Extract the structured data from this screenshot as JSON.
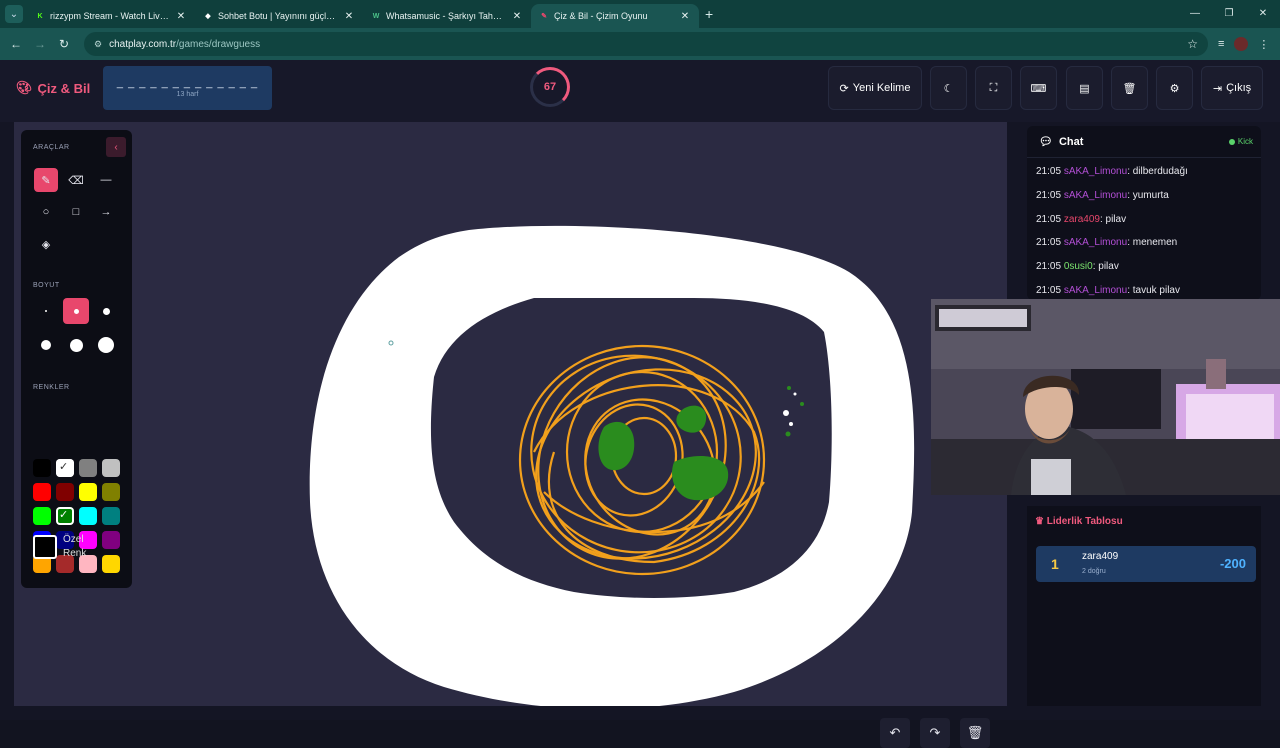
{
  "browser": {
    "tabs": [
      {
        "title": "rizzypm Stream - Watch Live on",
        "icon_color": "#53fc18",
        "icon": "K",
        "active": false
      },
      {
        "title": "Sohbet Botu | Yayınını güçlendir",
        "icon_color": "#ffffff",
        "icon": "◆",
        "active": false
      },
      {
        "title": "Whatsamusic - Şarkıyı Tahmin Et",
        "icon_color": "#4cc38a",
        "icon": "W",
        "active": false
      },
      {
        "title": "Çiz & Bil - Çizim Oyunu",
        "icon_color": "#e8476c",
        "icon": "✎",
        "active": true
      }
    ],
    "url_host": "chatplay.com.tr",
    "url_path": "/games/drawguess",
    "new_tab": "+"
  },
  "app": {
    "brand": "Çiz & Bil",
    "word_mask": "_ _ _ _ _ _ _ _ _ _ _ _ _",
    "word_hint": "13 harf",
    "timer": "67",
    "timer_fraction": 0.25,
    "buttons": {
      "new_word": "Yeni Kelime",
      "exit": "Çıkış"
    }
  },
  "tools": {
    "tools_label": "ARAÇLAR",
    "size_label": "BOYUT",
    "colors_label": "RENKLER",
    "custom_color": [
      "Özel",
      "Renk"
    ],
    "selected_tool": "brush",
    "selected_size": 1,
    "colors": [
      "#000000",
      "#ffffff",
      "#808080",
      "#c0c0c0",
      "#ff0000",
      "#800000",
      "#ffff00",
      "#808000",
      "#00ff00",
      "#008000",
      "#00ffff",
      "#008080",
      "#0000ff",
      "#000080",
      "#ff00ff",
      "#800080",
      "#ffa500",
      "#a52a2a",
      "#ffb6c1",
      "#ffd700"
    ],
    "selected_colors": [
      "#ffffff",
      "#008000"
    ]
  },
  "chat": {
    "title": "Chat",
    "platform": "Kick",
    "messages": [
      {
        "time": "21:05",
        "user": "sAKA_Limonu",
        "user_color": "purple",
        "text": ": dilberdudağı"
      },
      {
        "time": "21:05",
        "user": "sAKA_Limonu",
        "user_color": "purple",
        "text": ": yumurta"
      },
      {
        "time": "21:05",
        "user": "zara409",
        "user_color": "red",
        "text": ": pilav"
      },
      {
        "time": "21:05",
        "user": "sAKA_Limonu",
        "user_color": "purple",
        "text": ": menemen"
      },
      {
        "time": "21:05",
        "user": "0susi0",
        "user_color": "green",
        "text": ": pilav"
      },
      {
        "time": "21:05",
        "user": "sAKA_Limonu",
        "user_color": "purple",
        "text": ": tavuk pilav"
      }
    ]
  },
  "leaderboard": {
    "title": "Liderlik Tablosu",
    "rows": [
      {
        "rank": "1",
        "name": "zara409",
        "sub": "2 doğru",
        "score": "-200"
      }
    ]
  }
}
